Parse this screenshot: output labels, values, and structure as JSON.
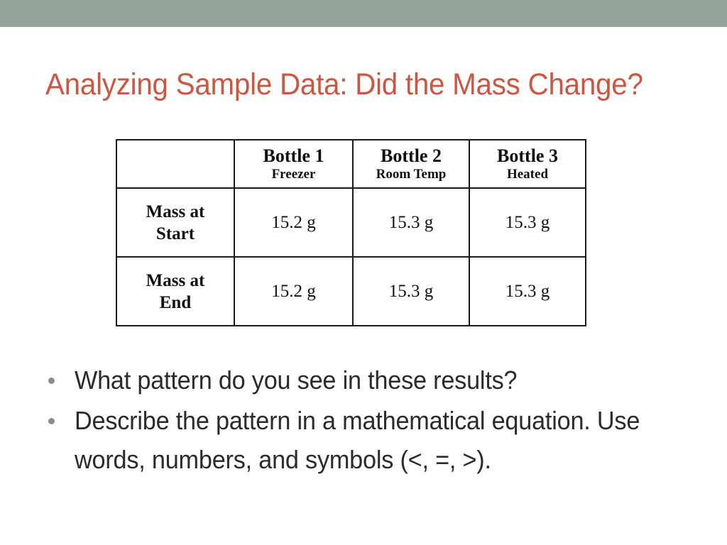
{
  "slide": {
    "title": "Analyzing Sample Data: Did the Mass Change?",
    "band_color": "#93a49d",
    "title_color": "#cb5742",
    "background_color": "#ffffff",
    "body_text_color": "#2b2b2b",
    "bullet_marker_color": "#8c8c8c"
  },
  "table": {
    "corner_label": "",
    "columns": [
      {
        "main": "Bottle 1",
        "sub": "Freezer"
      },
      {
        "main": "Bottle 2",
        "sub": "Room Temp"
      },
      {
        "main": "Bottle 3",
        "sub": "Heated"
      }
    ],
    "rows": [
      {
        "label_line1": "Mass at",
        "label_line2": "Start",
        "values": [
          "15.2 g",
          "15.3 g",
          "15.3 g"
        ]
      },
      {
        "label_line1": "Mass at",
        "label_line2": "End",
        "values": [
          "15.2 g",
          "15.3 g",
          "15.3 g"
        ]
      }
    ]
  },
  "bullets": [
    "What pattern do you see in these results?",
    "Describe the pattern in a mathematical equation. Use words, numbers, and symbols (<, =, >)."
  ],
  "chart_data": {
    "type": "table",
    "title": "Analyzing Sample Data: Did the Mass Change?",
    "columns": [
      "",
      "Bottle 1 (Freezer)",
      "Bottle 2 (Room Temp)",
      "Bottle 3 (Heated)"
    ],
    "rows": [
      [
        "Mass at Start",
        "15.2 g",
        "15.3 g",
        "15.3 g"
      ],
      [
        "Mass at End",
        "15.2 g",
        "15.3 g",
        "15.3 g"
      ]
    ],
    "units": "g",
    "numeric_values": {
      "mass_at_start": [
        15.2,
        15.3,
        15.3
      ],
      "mass_at_end": [
        15.2,
        15.3,
        15.3
      ]
    }
  }
}
